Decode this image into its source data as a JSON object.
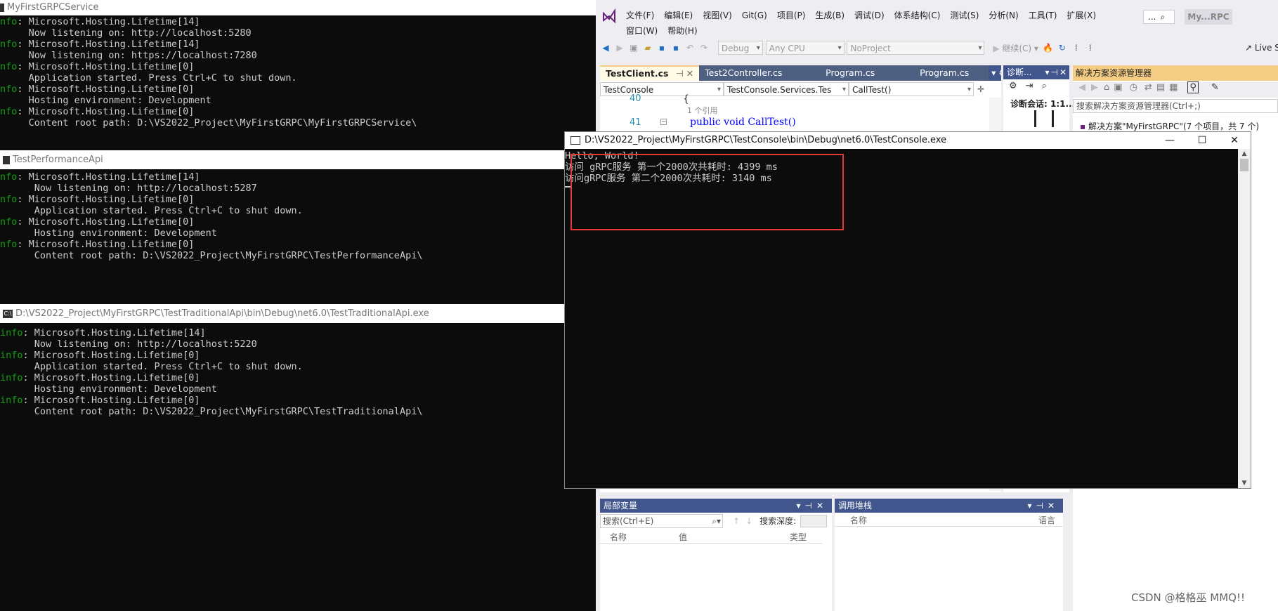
{
  "service_window": {
    "title": "MyFirstGRPCService",
    "lines": [
      {
        "prefix": "nfo",
        "text": ": Microsoft.Hosting.Lifetime[14]"
      },
      {
        "prefix": "",
        "text": "     Now listening on: http://localhost:5280"
      },
      {
        "prefix": "nfo",
        "text": ": Microsoft.Hosting.Lifetime[14]"
      },
      {
        "prefix": "",
        "text": "     Now listening on: https://localhost:7280"
      },
      {
        "prefix": "nfo",
        "text": ": Microsoft.Hosting.Lifetime[0]"
      },
      {
        "prefix": "",
        "text": "     Application started. Press Ctrl+C to shut down."
      },
      {
        "prefix": "nfo",
        "text": ": Microsoft.Hosting.Lifetime[0]"
      },
      {
        "prefix": "",
        "text": "     Hosting environment: Development"
      },
      {
        "prefix": "nfo",
        "text": ": Microsoft.Hosting.Lifetime[0]"
      },
      {
        "prefix": "",
        "text": "     Content root path: D:\\VS2022_Project\\MyFirstGRPC\\MyFirstGRPCService\\"
      }
    ]
  },
  "perf_window": {
    "title": "TestPerformanceApi",
    "lines": [
      {
        "prefix": "nfo",
        "text": ": Microsoft.Hosting.Lifetime[14]"
      },
      {
        "prefix": "",
        "text": "      Now listening on: http://localhost:5287"
      },
      {
        "prefix": "nfo",
        "text": ": Microsoft.Hosting.Lifetime[0]"
      },
      {
        "prefix": "",
        "text": "      Application started. Press Ctrl+C to shut down."
      },
      {
        "prefix": "nfo",
        "text": ": Microsoft.Hosting.Lifetime[0]"
      },
      {
        "prefix": "",
        "text": "      Hosting environment: Development"
      },
      {
        "prefix": "nfo",
        "text": ": Microsoft.Hosting.Lifetime[0]"
      },
      {
        "prefix": "",
        "text": "      Content root path: D:\\VS2022_Project\\MyFirstGRPC\\TestPerformanceApi\\"
      }
    ]
  },
  "trad_window": {
    "title": "D:\\VS2022_Project\\MyFirstGRPC\\TestTraditionalApi\\bin\\Debug\\net6.0\\TestTraditionalApi.exe",
    "icon_label": "C:\\",
    "lines": [
      {
        "prefix": "info",
        "text": ": Microsoft.Hosting.Lifetime[14]"
      },
      {
        "prefix": "",
        "text": "      Now listening on: http://localhost:5220"
      },
      {
        "prefix": "info",
        "text": ": Microsoft.Hosting.Lifetime[0]"
      },
      {
        "prefix": "",
        "text": "      Application started. Press Ctrl+C to shut down."
      },
      {
        "prefix": "info",
        "text": ": Microsoft.Hosting.Lifetime[0]"
      },
      {
        "prefix": "",
        "text": "      Hosting environment: Development"
      },
      {
        "prefix": "info",
        "text": ": Microsoft.Hosting.Lifetime[0]"
      },
      {
        "prefix": "",
        "text": "      Content root path: D:\\VS2022_Project\\MyFirstGRPC\\TestTraditionalApi\\"
      }
    ]
  },
  "vs": {
    "menu_row1": [
      "文件(F)",
      "编辑(E)",
      "视图(V)",
      "Git(G)",
      "项目(P)",
      "生成(B)",
      "调试(D)",
      "体系结构(C)",
      "测试(S)",
      "分析(N)",
      "工具(T)",
      "扩展(X)"
    ],
    "menu_row2": [
      "窗口(W)",
      "帮助(H)"
    ],
    "search_label": "...",
    "solution_short": "My...RPC",
    "config": "Debug",
    "platform": "Any CPU",
    "project": "NoProject",
    "continue_label": "继续(C) ▾",
    "live_share": "Live S",
    "tabs": [
      "TestClient.cs",
      "Test2Controller.cs",
      "Program.cs",
      "Program.cs"
    ],
    "nav_project": "TestConsole",
    "nav_class": "TestConsole.Services.Tes",
    "nav_member": "CallTest()",
    "line_40": "40",
    "line_41": "41",
    "brace": "{",
    "ref_count": "1 个引用",
    "code_line": "public void CallTest()",
    "diag_title": "诊断...",
    "diag_session": "诊断会话: 1:1...",
    "sol_title": "解决方案资源管理器",
    "sol_search": "搜索解决方案资源管理器(Ctrl+;)",
    "sol_item": "解决方案\"MyFirstGRPC\"(7 个项目，共 7 个)",
    "locals_title": "局部变量",
    "locals_search": "搜索(Ctrl+E)",
    "search_depth": "搜索深度:",
    "col_name": "名称",
    "col_value": "值",
    "col_type": "类型",
    "callstack_title": "调用堆栈",
    "col_lang": "语言"
  },
  "client_window": {
    "title": "D:\\VS2022_Project\\MyFirstGRPC\\TestConsole\\bin\\Debug\\net6.0\\TestConsole.exe",
    "lines": [
      "Hello, World!",
      "访问 gRPC服务 第一个2000次共耗时: 4399 ms",
      "访问gRPC服务 第二个2000次共耗时: 3140 ms"
    ],
    "highlight_color": "#e53935"
  },
  "watermark": "CSDN @格格巫 MMQ!!"
}
